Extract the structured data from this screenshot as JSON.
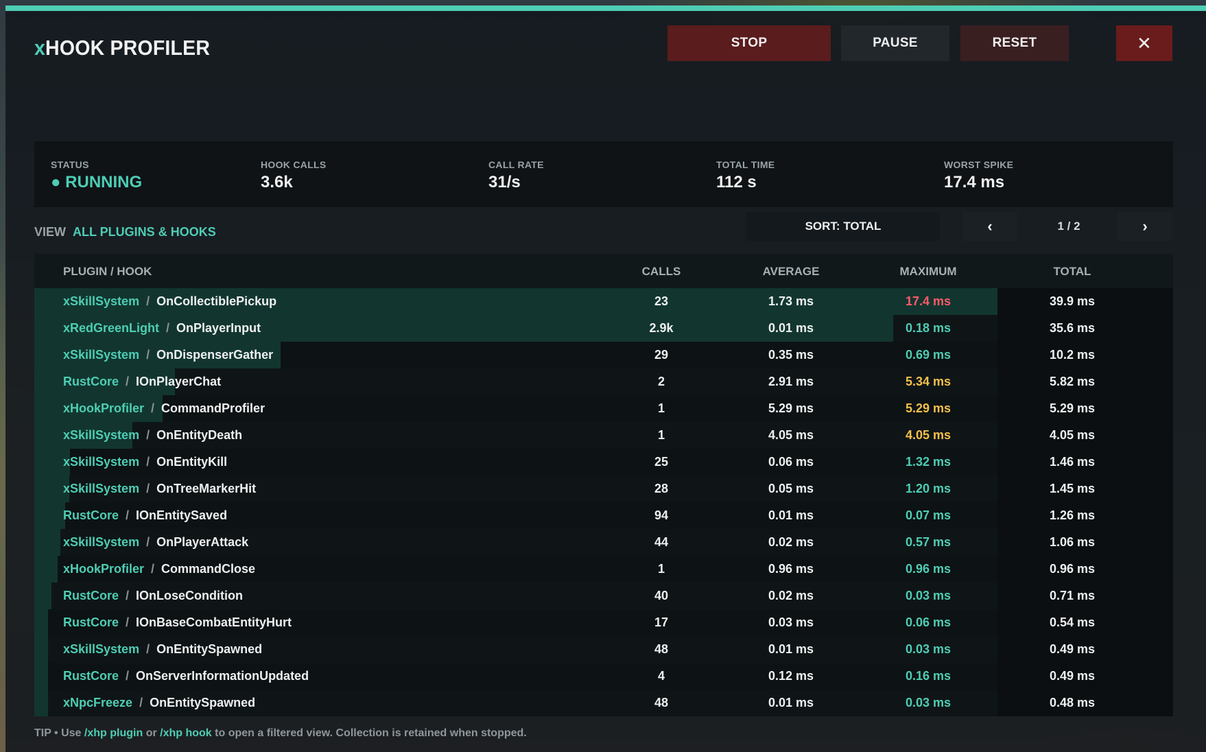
{
  "title": {
    "accent": "x",
    "rest": "HOOK PROFILER"
  },
  "buttons": {
    "stop": "STOP",
    "pause": "PAUSE",
    "reset": "RESET",
    "close": "✕"
  },
  "stats": {
    "status": {
      "label": "STATUS",
      "value": "● RUNNING"
    },
    "hook_calls": {
      "label": "HOOK CALLS",
      "value": "3.6k"
    },
    "call_rate": {
      "label": "CALL RATE",
      "value": "31/s"
    },
    "total_time": {
      "label": "TOTAL TIME",
      "value": "112 s"
    },
    "worst_spike": {
      "label": "WORST SPIKE",
      "value": "17.4 ms"
    }
  },
  "view": {
    "label": "VIEW",
    "value": "ALL PLUGINS & HOOKS"
  },
  "sort": {
    "label": "SORT: TOTAL"
  },
  "pagination": {
    "prev": "‹",
    "next": "›",
    "info": "1 / 2"
  },
  "columns": {
    "name": "PLUGIN / HOOK",
    "calls": "CALLS",
    "average": "AVERAGE",
    "maximum": "MAXIMUM",
    "total": "TOTAL"
  },
  "colors": {
    "accent": "#4ecdb4",
    "max_red": "#ff5a6a",
    "max_yellow": "#f2c04a",
    "max_teal": "#4ecdb4"
  },
  "rows": [
    {
      "plugin": "xSkillSystem",
      "hook": "OnCollectiblePickup",
      "calls": "23",
      "average": "1.73 ms",
      "maximum": "17.4 ms",
      "total": "39.9 ms",
      "level": "red",
      "share": 1.0
    },
    {
      "plugin": "xRedGreenLight",
      "hook": "OnPlayerInput",
      "calls": "2.9k",
      "average": "0.01 ms",
      "maximum": "0.18 ms",
      "total": "35.6 ms",
      "level": "teal",
      "share": 0.892
    },
    {
      "plugin": "xSkillSystem",
      "hook": "OnDispenserGather",
      "calls": "29",
      "average": "0.35 ms",
      "maximum": "0.69 ms",
      "total": "10.2 ms",
      "level": "teal",
      "share": 0.256
    },
    {
      "plugin": "RustCore",
      "hook": "IOnPlayerChat",
      "calls": "2",
      "average": "2.91 ms",
      "maximum": "5.34 ms",
      "total": "5.82 ms",
      "level": "yellow",
      "share": 0.146
    },
    {
      "plugin": "xHookProfiler",
      "hook": "CommandProfiler",
      "calls": "1",
      "average": "5.29 ms",
      "maximum": "5.29 ms",
      "total": "5.29 ms",
      "level": "yellow",
      "share": 0.133
    },
    {
      "plugin": "xSkillSystem",
      "hook": "OnEntityDeath",
      "calls": "1",
      "average": "4.05 ms",
      "maximum": "4.05 ms",
      "total": "4.05 ms",
      "level": "yellow",
      "share": 0.102
    },
    {
      "plugin": "xSkillSystem",
      "hook": "OnEntityKill",
      "calls": "25",
      "average": "0.06 ms",
      "maximum": "1.32 ms",
      "total": "1.46 ms",
      "level": "teal",
      "share": 0.037
    },
    {
      "plugin": "xSkillSystem",
      "hook": "OnTreeMarkerHit",
      "calls": "28",
      "average": "0.05 ms",
      "maximum": "1.20 ms",
      "total": "1.45 ms",
      "level": "teal",
      "share": 0.036
    },
    {
      "plugin": "RustCore",
      "hook": "IOnEntitySaved",
      "calls": "94",
      "average": "0.01 ms",
      "maximum": "0.07 ms",
      "total": "1.26 ms",
      "level": "teal",
      "share": 0.032
    },
    {
      "plugin": "xSkillSystem",
      "hook": "OnPlayerAttack",
      "calls": "44",
      "average": "0.02 ms",
      "maximum": "0.57 ms",
      "total": "1.06 ms",
      "level": "teal",
      "share": 0.027
    },
    {
      "plugin": "xHookProfiler",
      "hook": "CommandClose",
      "calls": "1",
      "average": "0.96 ms",
      "maximum": "0.96 ms",
      "total": "0.96 ms",
      "level": "teal",
      "share": 0.024
    },
    {
      "plugin": "RustCore",
      "hook": "IOnLoseCondition",
      "calls": "40",
      "average": "0.02 ms",
      "maximum": "0.03 ms",
      "total": "0.71 ms",
      "level": "teal",
      "share": 0.018
    },
    {
      "plugin": "RustCore",
      "hook": "IOnBaseCombatEntityHurt",
      "calls": "17",
      "average": "0.03 ms",
      "maximum": "0.06 ms",
      "total": "0.54 ms",
      "level": "teal",
      "share": 0.014
    },
    {
      "plugin": "xSkillSystem",
      "hook": "OnEntitySpawned",
      "calls": "48",
      "average": "0.01 ms",
      "maximum": "0.03 ms",
      "total": "0.49 ms",
      "level": "teal",
      "share": 0.012
    },
    {
      "plugin": "RustCore",
      "hook": "OnServerInformationUpdated",
      "calls": "4",
      "average": "0.12 ms",
      "maximum": "0.16 ms",
      "total": "0.49 ms",
      "level": "teal",
      "share": 0.012
    },
    {
      "plugin": "xNpcFreeze",
      "hook": "OnEntitySpawned",
      "calls": "48",
      "average": "0.01 ms",
      "maximum": "0.03 ms",
      "total": "0.48 ms",
      "level": "teal",
      "share": 0.012
    }
  ],
  "tip": {
    "prefix": "TIP • Use",
    "cmd1": "/xhp plugin",
    "mid": "or",
    "cmd2": "/xhp hook",
    "suffix": "to open a filtered view. Collection is retained when stopped."
  }
}
